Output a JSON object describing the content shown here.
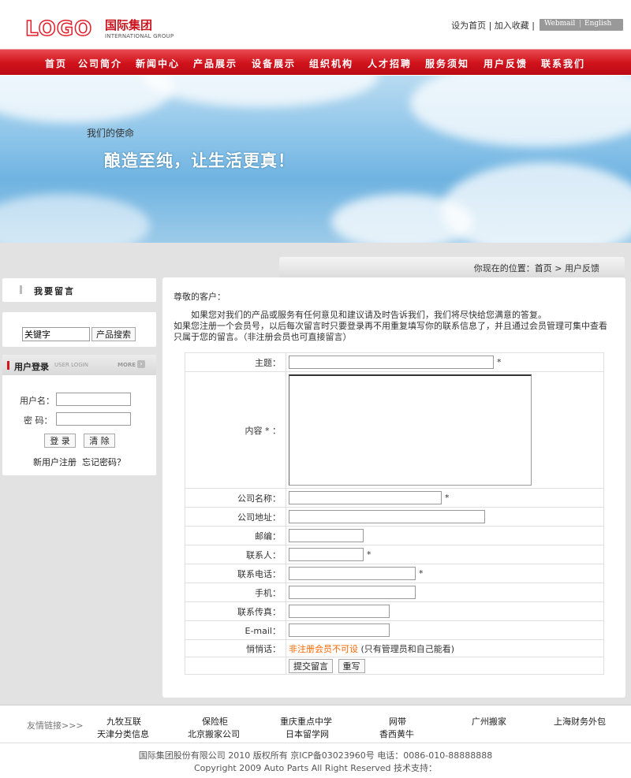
{
  "header": {
    "logo_text": "LOGO",
    "logo_cn": "国际集团",
    "logo_en": "INTERNATIONAL GROUP",
    "set_home": "设为首页",
    "add_fav": "加入收藏",
    "webmail": "Webmail",
    "english": "English"
  },
  "nav": [
    "首页",
    "公司简介",
    "新闻中心",
    "产品展示",
    "设备展示",
    "组织机构",
    "人才招聘",
    "服务须知",
    "用户反馈",
    "联系我们"
  ],
  "banner": {
    "subtitle": "我们的使命",
    "title": "酿造至纯，让生活更真！"
  },
  "breadcrumb": {
    "prefix": "你现在的位置：",
    "home": "首页",
    "sep": " > ",
    "current": "用户反馈"
  },
  "sidebar": {
    "leave_msg_title": "我要留言",
    "search_placeholder": "关键字",
    "search_button": "产品搜索",
    "login_title": "用户登录",
    "login_title_en": "USER LOGIN",
    "more": "MORE",
    "username_label": "用户名：",
    "password_label": "密  码：",
    "login_button": "登 录",
    "clear_button": "清 除",
    "register": "新用户注册",
    "forgot": "忘记密码？"
  },
  "main": {
    "greeting": "尊敬的客户：",
    "para1": "如果您对我们的产品或服务有任何意见和建议请及时告诉我们，我们将尽快给您满意的答复。",
    "para2": "如果您注册一个会员号，以后每次留言时只要登录再不用重复填写你的联系信息了，并且通过会员管理可集中查看",
    "para3": "只属于您的留言。（非注册会员也可直接留言）",
    "form": {
      "subject": "主题：",
      "content": "内容 * ：",
      "company": "公司名称：",
      "address": "公司地址：",
      "zip": "邮编：",
      "contact": "联系人：",
      "phone": "联系电话：",
      "mobile": "手机：",
      "fax": "联系传真：",
      "email": "E-mail：",
      "whisper": "悄悄话：",
      "whisper_note": "非注册会员不可设",
      "whisper_hint": "(只有管理员和自己能看)",
      "star": "*",
      "submit": "提交留言",
      "reset": "重写"
    }
  },
  "footer": {
    "friend_label": "友情链接>>>",
    "links_row1": [
      "九牧互联",
      "保险柜",
      "重庆重点中学",
      "网带",
      "广州搬家",
      "上海财务外包"
    ],
    "links_row2": [
      "天津分类信息",
      "北京搬家公司",
      "日本留学网",
      "香西黄牛"
    ],
    "copyright1": "国际集团股份有限公司 2010 版权所有 京ICP备03023960号 电话：0086-010-88888888",
    "copyright2": "Copyright 2009 Auto Parts All Right Reserved 技术支持："
  },
  "colors": {
    "nav_red": "#d0111b",
    "logo_red": "#e21e2a",
    "highlight_orange": "#ff6600"
  }
}
